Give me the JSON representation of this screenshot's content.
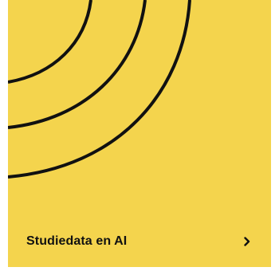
{
  "card": {
    "title": "Studiedata en AI",
    "action_icon": "chevron-right-icon",
    "background_color": "#f4d44d",
    "line_color": "#111111"
  }
}
